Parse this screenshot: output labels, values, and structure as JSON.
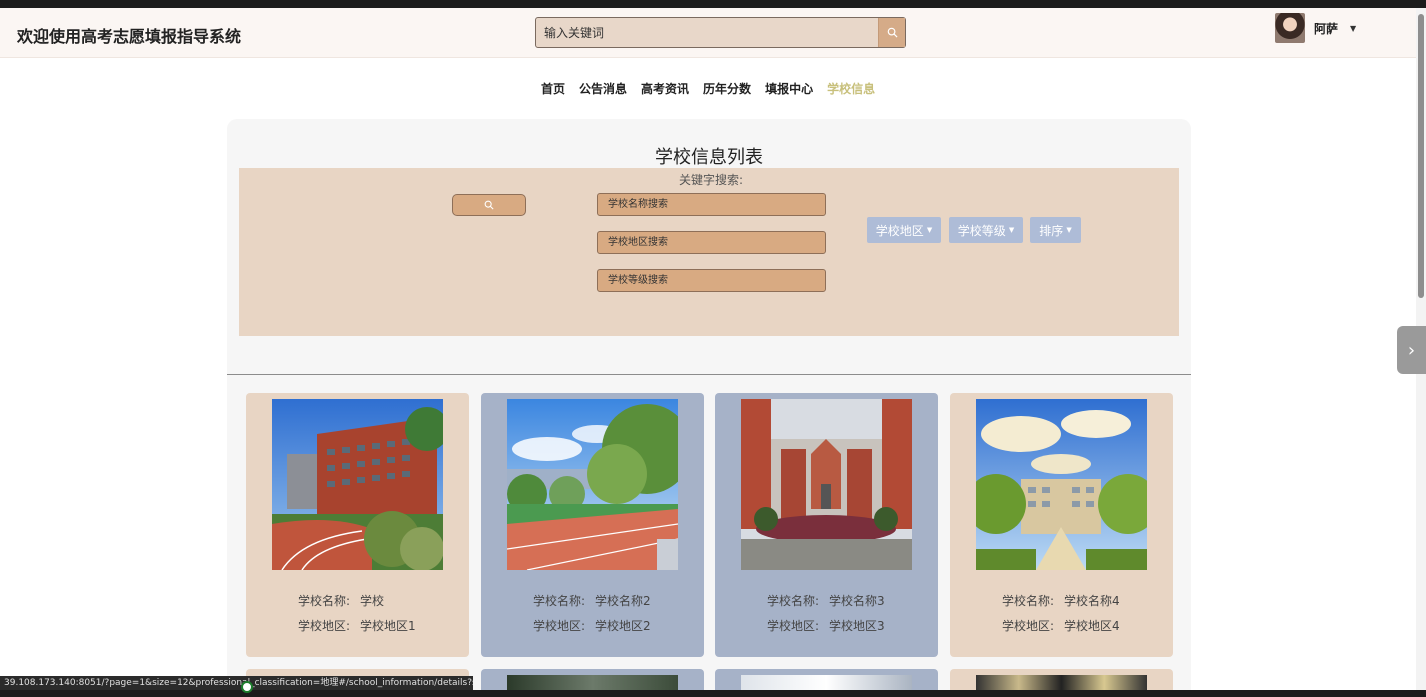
{
  "header": {
    "site_title": "欢迎使用高考志愿填报指导系统",
    "search_placeholder": "输入关键词",
    "user_name": "阿萨"
  },
  "nav": {
    "items": [
      "首页",
      "公告消息",
      "高考资讯",
      "历年分数",
      "填报中心",
      "学校信息"
    ],
    "active": "学校信息"
  },
  "main": {
    "title": "学校信息列表",
    "keyword_label": "关键字搜索:",
    "filters": {
      "name_placeholder": "学校名称搜索",
      "region_placeholder": "学校地区搜索",
      "level_placeholder": "学校等级搜索"
    },
    "dropdowns": [
      "学校地区",
      "学校等级",
      "排序"
    ]
  },
  "cards": [
    {
      "name_label": "学校名称:",
      "name": "学校",
      "region_label": "学校地区:",
      "region": "学校地区1",
      "theme": "beige",
      "icon": "campus-photo"
    },
    {
      "name_label": "学校名称:",
      "name": "学校名称2",
      "region_label": "学校地区:",
      "region": "学校地区2",
      "theme": "blue",
      "icon": "campus-photo"
    },
    {
      "name_label": "学校名称:",
      "name": "学校名称3",
      "region_label": "学校地区:",
      "region": "学校地区3",
      "theme": "blue",
      "icon": "campus-photo"
    },
    {
      "name_label": "学校名称:",
      "name": "学校名称4",
      "region_label": "学校地区:",
      "region": "学校地区4",
      "theme": "beige",
      "icon": "campus-photo"
    }
  ],
  "status_bar": {
    "url": "39.108.173.140:8051/?page=1&size=12&professional_classification=地理#/school_information/details?scho..."
  },
  "colors": {
    "accent": "#d8aa82",
    "active_nav": "#c8c07c",
    "card_beige": "#e8d5c4",
    "card_blue": "#a6b2c8",
    "dropdown": "#aebcd7"
  }
}
